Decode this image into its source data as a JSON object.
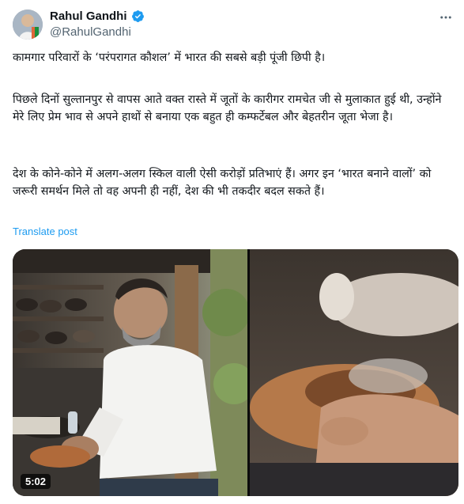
{
  "author": {
    "name": "Rahul Gandhi",
    "handle": "@RahulGandhi",
    "verified_icon": "verified-badge-icon",
    "verified_color": "#1d9bf0"
  },
  "post": {
    "paragraph_1": "कामगार परिवारों के ‘परंपरागत कौशल’ में भारत की सबसे बड़ी पूंजी छिपी है।",
    "paragraph_2": "पिछले दिनों सुल्तानपुर से वापस आते वक्त रास्ते में जूतों के कारीगर रामचेत जी से मुलाकात हुई थी, उन्होंने मेरे लिए प्रेम भाव से अपने हाथों से बनाया एक बहुत ही कम्फर्टेबल और बेहतरीन जूता भेजा है।",
    "paragraph_3": "देश के कोने-कोने में अलग-अलग स्किल वाली ऐसी करोड़ों प्रतिभाएं हैं। अगर इन ‘भारत बनाने वालों’ को जरूरी समर्थन मिले तो वह अपनी ही नहीं, देश की भी तकदीर बदल सकते हैं।",
    "translate_label": "Translate post"
  },
  "media": {
    "duration": "5:02"
  },
  "more_icon": "more-horizontal-icon",
  "accent_color": "#1d9bf0"
}
